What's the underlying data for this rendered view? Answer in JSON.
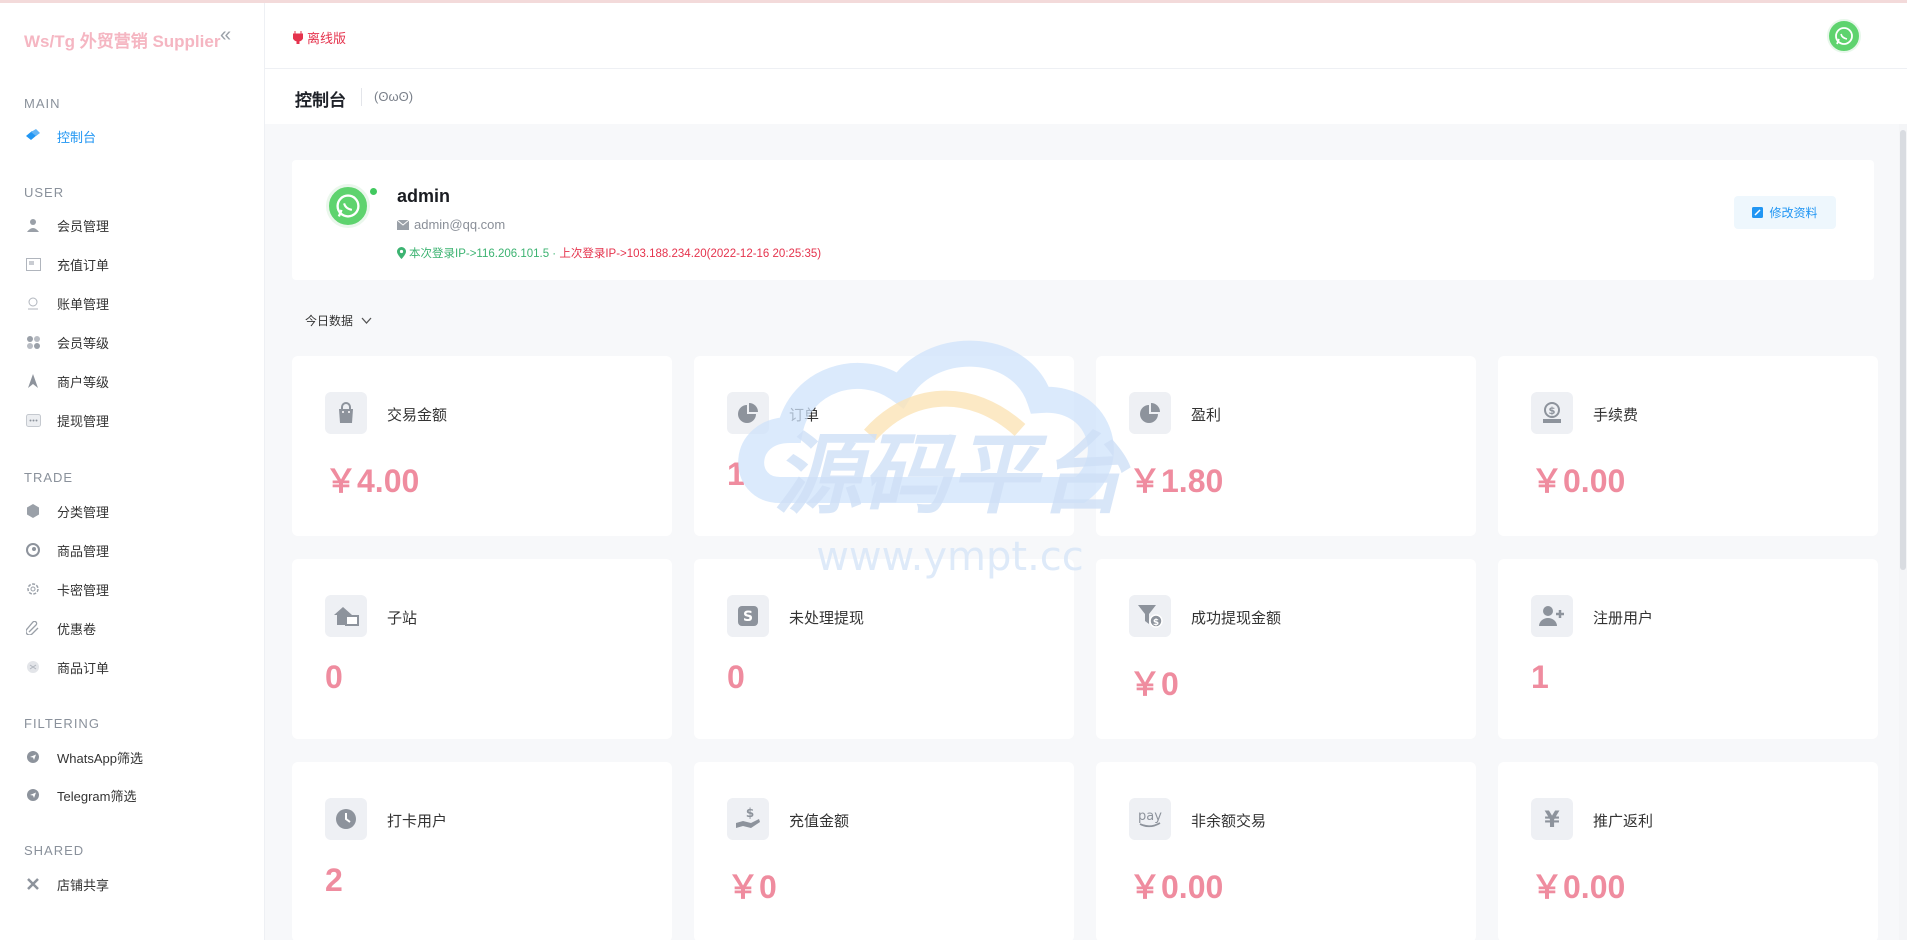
{
  "sidebar": {
    "brand": "Ws/Tg 外贸营销 Supplier",
    "sections": {
      "main": "MAIN",
      "user": "USER",
      "trade": "TRADE",
      "filtering": "FILTERING",
      "shared": "SHARED"
    },
    "items": {
      "dashboard": "控制台",
      "members": "会员管理",
      "recharge_orders": "充值订单",
      "bills": "账单管理",
      "member_levels": "会员等级",
      "merchant_levels": "商户等级",
      "withdraw": "提现管理",
      "categories": "分类管理",
      "products": "商品管理",
      "card_keys": "卡密管理",
      "coupons": "优惠卷",
      "product_orders": "商品订单",
      "whatsapp_filter": "WhatsApp筛选",
      "telegram_filter": "Telegram筛选",
      "shop_share": "店铺共享"
    }
  },
  "header": {
    "offline_label": "离线版",
    "page_title": "控制台",
    "emoticon": "(ʘωʘ)"
  },
  "profile": {
    "username": "admin",
    "email": "admin@qq.com",
    "current_login": "本次登录IP->116.206.101.5 ·",
    "previous_login": "上次登录IP->103.188.234.20(2022-12-16 20:25:35)",
    "edit_label": "修改资料"
  },
  "range_select": "今日数据",
  "stats": [
    {
      "label": "交易金额",
      "value": "￥4.00",
      "icon": "shopping-bag-icon"
    },
    {
      "label": "订单",
      "value": "1",
      "icon": "pie-chart-icon"
    },
    {
      "label": "盈利",
      "value": "￥1.80",
      "icon": "pie-chart-icon"
    },
    {
      "label": "手续费",
      "value": "￥0.00",
      "icon": "money-hand-icon"
    },
    {
      "label": "子站",
      "value": "0",
      "icon": "home-site-icon"
    },
    {
      "label": "未处理提现",
      "value": "0",
      "icon": "dollar-badge-icon"
    },
    {
      "label": "成功提现金额",
      "value": "￥0",
      "icon": "filter-dollar-icon"
    },
    {
      "label": "注册用户",
      "value": "1",
      "icon": "user-plus-icon"
    },
    {
      "label": "打卡用户",
      "value": "2",
      "icon": "clock-icon"
    },
    {
      "label": "充值金额",
      "value": "￥0",
      "icon": "hand-dollar-icon"
    },
    {
      "label": "非余额交易",
      "value": "￥0.00",
      "icon": "pay-icon"
    },
    {
      "label": "推广返利",
      "value": "￥0.00",
      "icon": "yen-icon"
    }
  ],
  "watermark": {
    "title": "源码平台",
    "url": "www.ympt.cc"
  },
  "colors": {
    "accent": "#2196f3",
    "value_pink": "#ef8c9f",
    "online_green": "#42c95f",
    "alert_red": "#e5334d"
  }
}
